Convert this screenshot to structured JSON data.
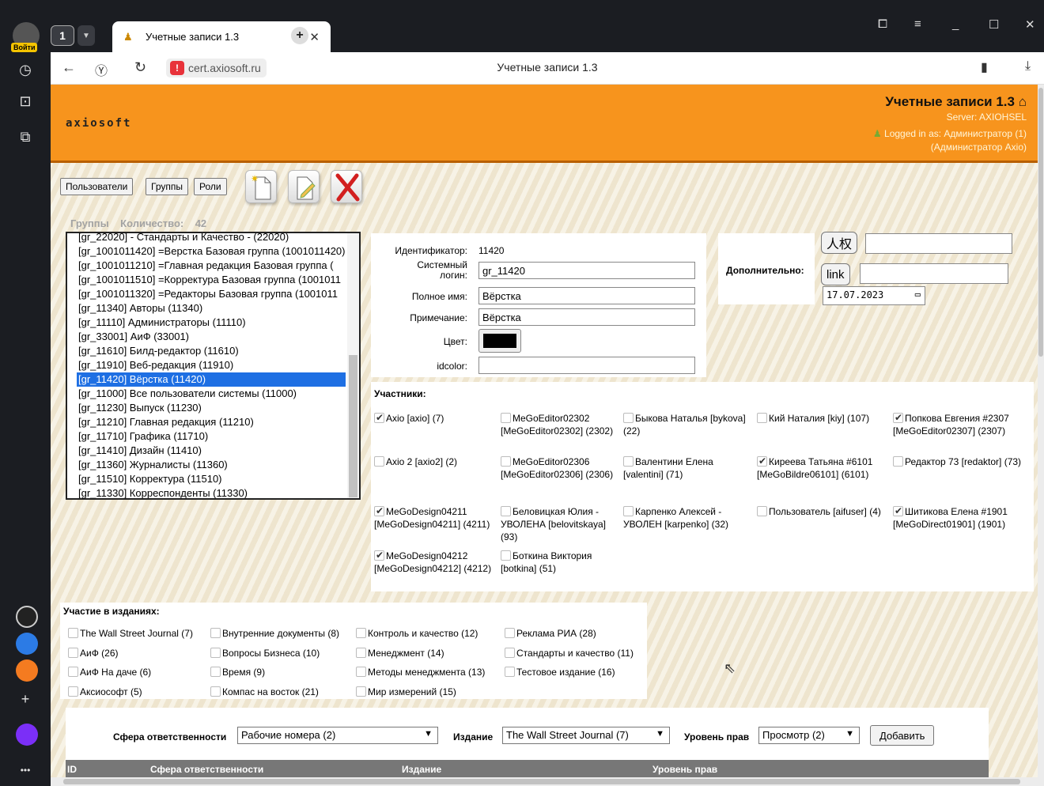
{
  "browser": {
    "login_badge": "Войти",
    "tab_count": "1",
    "tab_title": "Учетные записи 1.3",
    "url": "cert.axiosoft.ru",
    "page_title": "Учетные записи 1.3"
  },
  "header": {
    "logo": "axiosoft",
    "title": "Учетные записи 1.3",
    "server": "Server: AXIOHSEL",
    "logged_in": "Logged in as: Администратор (1)",
    "logged_in_2": "(Администратор Axio)"
  },
  "toolbar": {
    "users_label": "Пользователи",
    "groups_label": "Группы",
    "roles_label": "Роли"
  },
  "groups": {
    "caption": "Группы",
    "count_label": "Количество:",
    "count": "42",
    "items": [
      "[gr_22020] - Стандарты и Качество - (22020)",
      "[gr_1001011420] =Верстка Базовая группа (1001011420)",
      "[gr_1001011210] =Главная редакция Базовая группа (",
      "[gr_1001011510] =Корректура Базовая группа (1001011",
      "[gr_1001011320] =Редакторы Базовая группа (1001011",
      "[gr_11340] Авторы (11340)",
      "[gr_11110] Администраторы (11110)",
      "[gr_33001] АиФ (33001)",
      "[gr_11610] Билд-редактор (11610)",
      "[gr_11910] Веб-редакция (11910)",
      "[gr_11420] Вёрстка (11420)",
      "[gr_11000] Все пользователи системы (11000)",
      "[gr_11230] Выпуск (11230)",
      "[gr_11210] Главная редакция (11210)",
      "[gr_11710] Графика (11710)",
      "[gr_11410] Дизайн (11410)",
      "[gr_11360] Журналисты (11360)",
      "[gr_11510] Корректура (11510)",
      "[gr_11330] Корреспонденты (11330)"
    ],
    "selected_index": 10
  },
  "form": {
    "id_label": "Идентификатор:",
    "id_value": "11420",
    "login_label_1": "Системный",
    "login_label_2": "логин:",
    "login_value": "gr_11420",
    "fullname_label": "Полное имя:",
    "fullname_value": "Вёрстка",
    "note_label": "Примечание:",
    "note_value": "Вёрстка",
    "color_label": "Цвет:",
    "color_value": "#000000",
    "idcolor_label": "idcolor:",
    "idcolor_value": ""
  },
  "extra": {
    "label": "Дополнительно:",
    "btn1": "人权",
    "btn2": "link",
    "input1_value": "",
    "input2_value": "",
    "date_value": "17.07.2023"
  },
  "members": {
    "caption": "Участники:",
    "items": [
      {
        "text": "Axio [axio] (7)",
        "checked": true
      },
      {
        "text": "MeGoEditor02302 [MeGoEditor02302] (2302)",
        "checked": false
      },
      {
        "text": "Быкова Наталья [bykova] (22)",
        "checked": false
      },
      {
        "text": "Кий Наталия [kiy] (107)",
        "checked": false
      },
      {
        "text": "Попкова Евгения #2307 [MeGoEditor02307] (2307)",
        "checked": true
      },
      {
        "text": "Axio 2 [axio2] (2)",
        "checked": false
      },
      {
        "text": "MeGoEditor02306 [MeGoEditor02306] (2306)",
        "checked": false
      },
      {
        "text": "Валентини Елена [valentini] (71)",
        "checked": false
      },
      {
        "text": "Киреева Татьяна #6101 [MeGoBildre06101] (6101)",
        "checked": true
      },
      {
        "text": "Редактор 73 [redaktor] (73)",
        "checked": false
      },
      {
        "text": "MeGoDesign04211 [MeGoDesign04211] (4211)",
        "checked": true
      },
      {
        "text": "Беловицкая Юлия - УВОЛЕНА [belovitskaya] (93)",
        "checked": false
      },
      {
        "text": "Карпенко Алексей - УВОЛЕН [karpenko] (32)",
        "checked": false
      },
      {
        "text": "Пользователь [aifuser] (4)",
        "checked": false
      },
      {
        "text": "Шитикова Елена #1901 [MeGoDirect01901] (1901)",
        "checked": true
      },
      {
        "text": "MeGoDesign04212 [MeGoDesign04212] (4212)",
        "checked": true
      },
      {
        "text": "Боткина Виктория [botkina] (51)",
        "checked": false
      }
    ]
  },
  "editions": {
    "caption": "Участие в изданиях:",
    "items": [
      "The Wall Street Journal (7)",
      "Внутренние документы (8)",
      "Контроль и качество (12)",
      "Реклама РИА (28)",
      "АиФ (26)",
      "Вопросы Бизнеса (10)",
      "Менеджмент (14)",
      "Стандарты и качество (11)",
      "АиФ На даче (6)",
      "Время (9)",
      "Методы менеджмента (13)",
      "Тестовое издание (16)",
      "Аксиософт (5)",
      "Компас на восток (21)",
      "Мир измерений (15)"
    ]
  },
  "responsibility": {
    "sphere_label": "Сфера ответственности",
    "sphere_value": "Рабочие номера (2)",
    "edition_label": "Издание",
    "edition_value": "The Wall Street Journal (7)",
    "level_label": "Уровень прав",
    "level_value": "Просмотр (2)",
    "add_label": "Добавить",
    "columns": [
      "ID",
      "Сфера ответственности",
      "Издание",
      "Уровень прав"
    ]
  }
}
